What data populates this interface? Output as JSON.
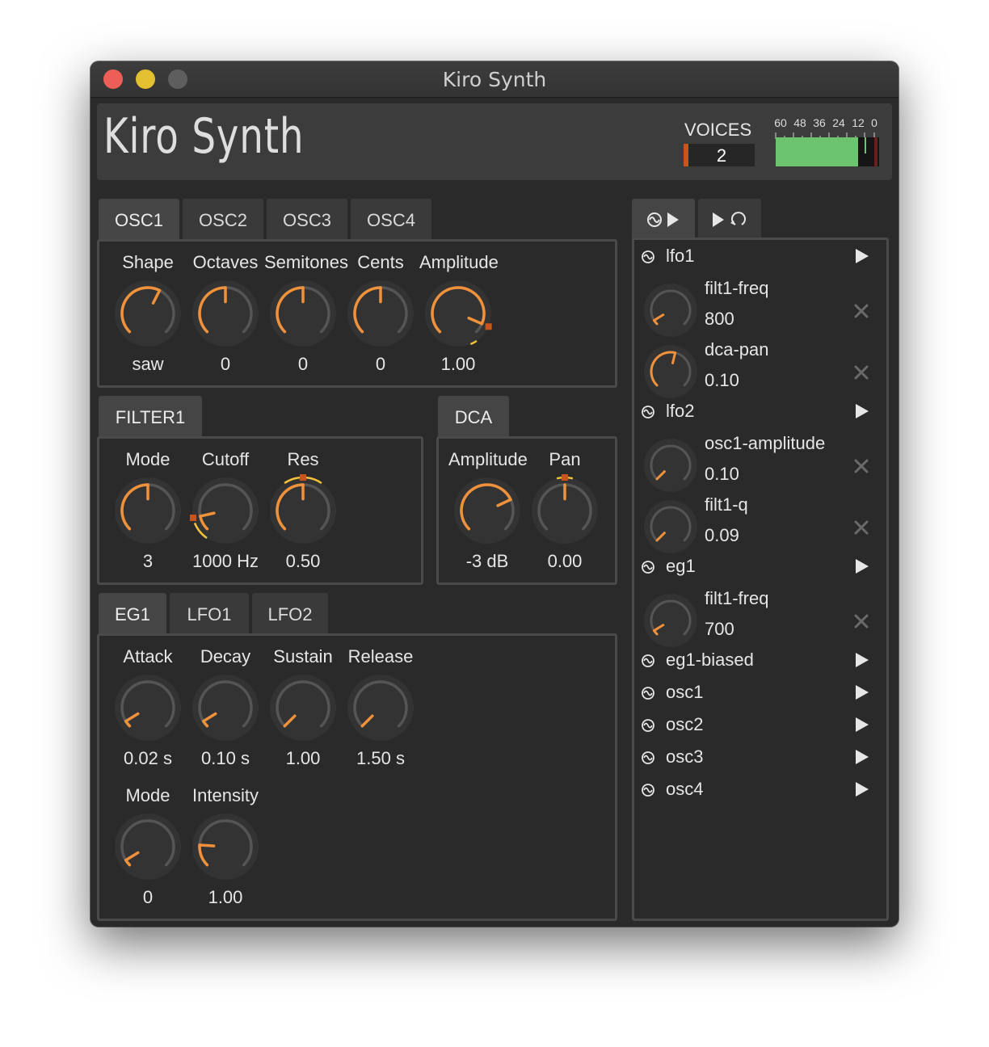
{
  "window": {
    "title": "Kiro Synth"
  },
  "header": {
    "logo": "Kiro Synth",
    "voices_label": "VOICES",
    "voices_value": "2",
    "meter": {
      "scale": [
        "60",
        "48",
        "36",
        "24",
        "12",
        "0"
      ],
      "level": 0.8
    }
  },
  "osc_tabs": [
    "OSC1",
    "OSC2",
    "OSC3",
    "OSC4"
  ],
  "osc_knobs": [
    {
      "label": "Shape",
      "value": "saw",
      "position": 0.6
    },
    {
      "label": "Octaves",
      "value": "0",
      "position": 0.5
    },
    {
      "label": "Semitones",
      "value": "0",
      "position": 0.5
    },
    {
      "label": "Cents",
      "value": "0",
      "position": 0.5
    },
    {
      "label": "Amplitude",
      "value": "1.00",
      "position": 0.92
    }
  ],
  "filter": {
    "tab": "FILTER1",
    "knobs": [
      {
        "label": "Mode",
        "value": "3",
        "position": 0.5
      },
      {
        "label": "Cutoff",
        "value": "1000 Hz",
        "position": 0.12
      },
      {
        "label": "Res",
        "value": "0.50",
        "position": 0.5
      }
    ]
  },
  "dca": {
    "tab": "DCA",
    "knobs": [
      {
        "label": "Amplitude",
        "value": "-3 dB",
        "position": 0.74
      },
      {
        "label": "Pan",
        "value": "0.00",
        "position": 0.5
      }
    ]
  },
  "mod_tabs": [
    "EG1",
    "LFO1",
    "LFO2"
  ],
  "eg_knobs": [
    {
      "label": "Attack",
      "value": "0.02 s",
      "position": 0.05
    },
    {
      "label": "Decay",
      "value": "0.10 s",
      "position": 0.05
    },
    {
      "label": "Sustain",
      "value": "1.00",
      "position": 0.0
    },
    {
      "label": "Release",
      "value": "1.50 s",
      "position": 0.0
    }
  ],
  "eg_knobs2": [
    {
      "label": "Mode",
      "value": "0",
      "position": 0.05
    },
    {
      "label": "Intensity",
      "value": "1.00",
      "position": 0.18
    }
  ],
  "matrix": {
    "tabs": [
      {
        "icon": "wave-play-icon"
      },
      {
        "icon": "play-loop-icon"
      }
    ],
    "rows": [
      {
        "type": "source",
        "name": "lfo1"
      },
      {
        "type": "target",
        "name": "filt1-freq",
        "value": "800",
        "position": 0.05
      },
      {
        "type": "target",
        "name": "dca-pan",
        "value": "0.10",
        "position": 0.55
      },
      {
        "type": "source",
        "name": "lfo2"
      },
      {
        "type": "target",
        "name": "osc1-amplitude",
        "value": "0.10",
        "position": 0.0
      },
      {
        "type": "target",
        "name": "filt1-q",
        "value": "0.09",
        "position": 0.0
      },
      {
        "type": "source",
        "name": "eg1"
      },
      {
        "type": "target",
        "name": "filt1-freq",
        "value": "700",
        "position": 0.05
      },
      {
        "type": "source",
        "name": "eg1-biased"
      },
      {
        "type": "source",
        "name": "osc1"
      },
      {
        "type": "source",
        "name": "osc2"
      },
      {
        "type": "source",
        "name": "osc3"
      },
      {
        "type": "source",
        "name": "osc4"
      }
    ]
  },
  "colors": {
    "accent": "#f0913c",
    "track": "#555555",
    "bg": "#2a2a2a",
    "meter": "#6cc46e",
    "close": "#ed5f56",
    "minimize": "#e3c02f",
    "zoom": "#5e5e5e"
  }
}
